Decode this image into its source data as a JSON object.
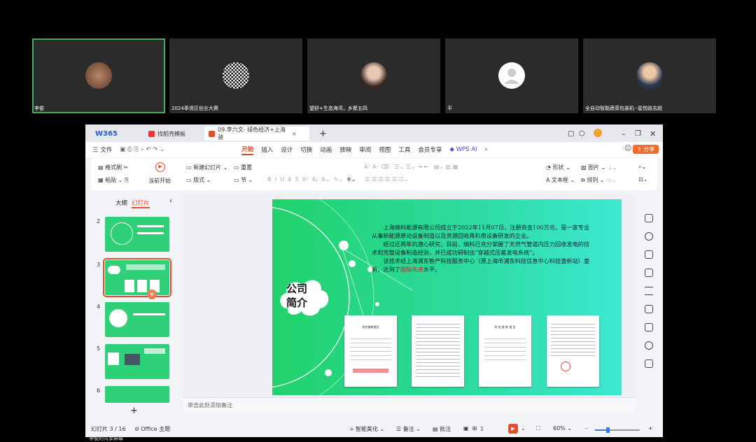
{
  "participants": [
    {
      "name": "李俊"
    },
    {
      "name": "2024奉贤区创业大赛"
    },
    {
      "name": "望舒+生态海湾，乡聚五四"
    },
    {
      "name": "平"
    },
    {
      "name": "全自动智能蔬菜包装机--星悦路志超"
    }
  ],
  "tabs": {
    "brand": "W365",
    "templates": "找稻壳模板",
    "doc": "09.李六文- 绿色经济+上海骑"
  },
  "menu": {
    "file": "三 文件",
    "items": [
      "开始",
      "插入",
      "设计",
      "切换",
      "动画",
      "放映",
      "审阅",
      "视图",
      "工具",
      "会员专享"
    ],
    "ai": "WPS AI",
    "share": "分享"
  },
  "ribbon": {
    "format_painter": "格式刷",
    "paste": "粘贴",
    "play_from": "当前开始",
    "new_slide": "新建幻灯片",
    "layout": "版式",
    "reset": "重置",
    "section": "节",
    "shape": "形状",
    "picture": "图片",
    "textbox": "文本框",
    "arrange": "排列"
  },
  "panel": {
    "outline": "大纲",
    "slides": "幻灯片",
    "numbers": [
      "2",
      "3",
      "4",
      "5",
      "6"
    ],
    "add": "+"
  },
  "slide": {
    "title_line1": "公司",
    "title_line2": "简介",
    "para1": "上海熵科能源有限公司成立于2022年11月07日，注册资金100万元，是一家专业从事新能源原动设备制造以及资源回收再利用设备研发的企业。",
    "para2": "经过近两年的潜心研究，目前，熵科已充分掌握了天然气管道内压力回收发电的技术和完整设备制造经验，并已成功研制出“穿越式压差发电系统”。",
    "para3_a": "该技术经上海浦东智产科技服务中心（原上海市浦东科技信息中心科技查新站）查新，达到了",
    "para3_red": "国际先进",
    "para3_b": "水平。",
    "doc_titles": [
      "科技查新报告",
      "",
      "科 技 查 新 报 告",
      ""
    ]
  },
  "notes": "单击此处添加备注",
  "status": {
    "slide": "幻灯片 3 / 16",
    "theme": "Office 主题",
    "beautify": "智能美化",
    "note": "备注",
    "comment": "批注",
    "zoom": "60%"
  },
  "footer": "李俊的共享屏幕"
}
